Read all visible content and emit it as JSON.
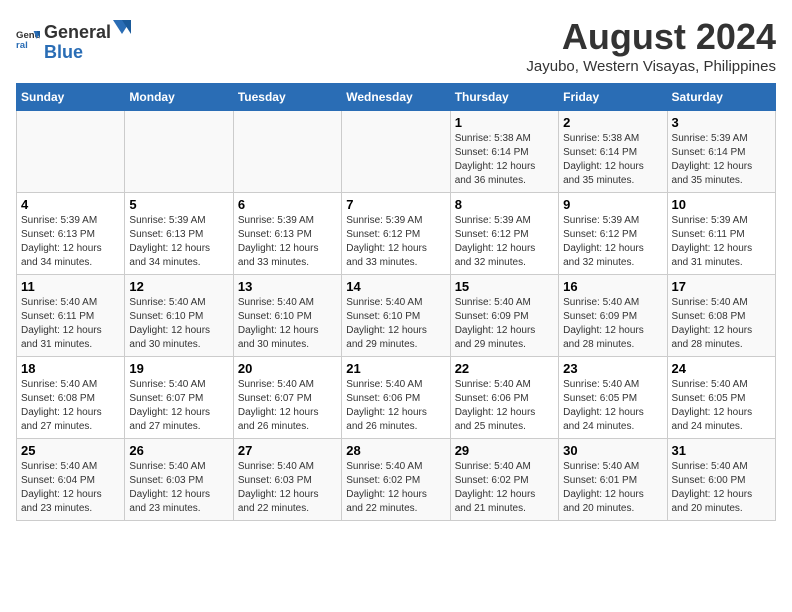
{
  "logo": {
    "text_general": "General",
    "text_blue": "Blue"
  },
  "title": "August 2024",
  "subtitle": "Jayubo, Western Visayas, Philippines",
  "headers": [
    "Sunday",
    "Monday",
    "Tuesday",
    "Wednesday",
    "Thursday",
    "Friday",
    "Saturday"
  ],
  "weeks": [
    [
      {
        "day": "",
        "info": ""
      },
      {
        "day": "",
        "info": ""
      },
      {
        "day": "",
        "info": ""
      },
      {
        "day": "",
        "info": ""
      },
      {
        "day": "1",
        "info": "Sunrise: 5:38 AM\nSunset: 6:14 PM\nDaylight: 12 hours\nand 36 minutes."
      },
      {
        "day": "2",
        "info": "Sunrise: 5:38 AM\nSunset: 6:14 PM\nDaylight: 12 hours\nand 35 minutes."
      },
      {
        "day": "3",
        "info": "Sunrise: 5:39 AM\nSunset: 6:14 PM\nDaylight: 12 hours\nand 35 minutes."
      }
    ],
    [
      {
        "day": "4",
        "info": "Sunrise: 5:39 AM\nSunset: 6:13 PM\nDaylight: 12 hours\nand 34 minutes."
      },
      {
        "day": "5",
        "info": "Sunrise: 5:39 AM\nSunset: 6:13 PM\nDaylight: 12 hours\nand 34 minutes."
      },
      {
        "day": "6",
        "info": "Sunrise: 5:39 AM\nSunset: 6:13 PM\nDaylight: 12 hours\nand 33 minutes."
      },
      {
        "day": "7",
        "info": "Sunrise: 5:39 AM\nSunset: 6:12 PM\nDaylight: 12 hours\nand 33 minutes."
      },
      {
        "day": "8",
        "info": "Sunrise: 5:39 AM\nSunset: 6:12 PM\nDaylight: 12 hours\nand 32 minutes."
      },
      {
        "day": "9",
        "info": "Sunrise: 5:39 AM\nSunset: 6:12 PM\nDaylight: 12 hours\nand 32 minutes."
      },
      {
        "day": "10",
        "info": "Sunrise: 5:39 AM\nSunset: 6:11 PM\nDaylight: 12 hours\nand 31 minutes."
      }
    ],
    [
      {
        "day": "11",
        "info": "Sunrise: 5:40 AM\nSunset: 6:11 PM\nDaylight: 12 hours\nand 31 minutes."
      },
      {
        "day": "12",
        "info": "Sunrise: 5:40 AM\nSunset: 6:10 PM\nDaylight: 12 hours\nand 30 minutes."
      },
      {
        "day": "13",
        "info": "Sunrise: 5:40 AM\nSunset: 6:10 PM\nDaylight: 12 hours\nand 30 minutes."
      },
      {
        "day": "14",
        "info": "Sunrise: 5:40 AM\nSunset: 6:10 PM\nDaylight: 12 hours\nand 29 minutes."
      },
      {
        "day": "15",
        "info": "Sunrise: 5:40 AM\nSunset: 6:09 PM\nDaylight: 12 hours\nand 29 minutes."
      },
      {
        "day": "16",
        "info": "Sunrise: 5:40 AM\nSunset: 6:09 PM\nDaylight: 12 hours\nand 28 minutes."
      },
      {
        "day": "17",
        "info": "Sunrise: 5:40 AM\nSunset: 6:08 PM\nDaylight: 12 hours\nand 28 minutes."
      }
    ],
    [
      {
        "day": "18",
        "info": "Sunrise: 5:40 AM\nSunset: 6:08 PM\nDaylight: 12 hours\nand 27 minutes."
      },
      {
        "day": "19",
        "info": "Sunrise: 5:40 AM\nSunset: 6:07 PM\nDaylight: 12 hours\nand 27 minutes."
      },
      {
        "day": "20",
        "info": "Sunrise: 5:40 AM\nSunset: 6:07 PM\nDaylight: 12 hours\nand 26 minutes."
      },
      {
        "day": "21",
        "info": "Sunrise: 5:40 AM\nSunset: 6:06 PM\nDaylight: 12 hours\nand 26 minutes."
      },
      {
        "day": "22",
        "info": "Sunrise: 5:40 AM\nSunset: 6:06 PM\nDaylight: 12 hours\nand 25 minutes."
      },
      {
        "day": "23",
        "info": "Sunrise: 5:40 AM\nSunset: 6:05 PM\nDaylight: 12 hours\nand 24 minutes."
      },
      {
        "day": "24",
        "info": "Sunrise: 5:40 AM\nSunset: 6:05 PM\nDaylight: 12 hours\nand 24 minutes."
      }
    ],
    [
      {
        "day": "25",
        "info": "Sunrise: 5:40 AM\nSunset: 6:04 PM\nDaylight: 12 hours\nand 23 minutes."
      },
      {
        "day": "26",
        "info": "Sunrise: 5:40 AM\nSunset: 6:03 PM\nDaylight: 12 hours\nand 23 minutes."
      },
      {
        "day": "27",
        "info": "Sunrise: 5:40 AM\nSunset: 6:03 PM\nDaylight: 12 hours\nand 22 minutes."
      },
      {
        "day": "28",
        "info": "Sunrise: 5:40 AM\nSunset: 6:02 PM\nDaylight: 12 hours\nand 22 minutes."
      },
      {
        "day": "29",
        "info": "Sunrise: 5:40 AM\nSunset: 6:02 PM\nDaylight: 12 hours\nand 21 minutes."
      },
      {
        "day": "30",
        "info": "Sunrise: 5:40 AM\nSunset: 6:01 PM\nDaylight: 12 hours\nand 20 minutes."
      },
      {
        "day": "31",
        "info": "Sunrise: 5:40 AM\nSunset: 6:00 PM\nDaylight: 12 hours\nand 20 minutes."
      }
    ]
  ]
}
